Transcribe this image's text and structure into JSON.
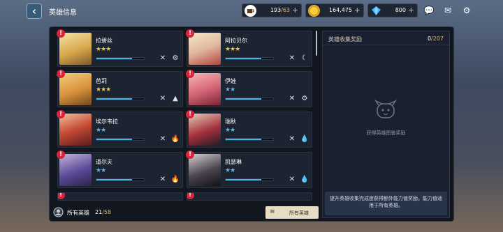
{
  "header": {
    "title": "英雄信息",
    "back_icon": "chevron-left-icon"
  },
  "resources": [
    {
      "icon": "coffee-cup-icon",
      "value": "193",
      "max": "/63",
      "color": "#e6b35a"
    },
    {
      "icon": "gold-coin-icon",
      "value": "164,475",
      "color": "#f2b21c"
    },
    {
      "icon": "diamond-gem-icon",
      "value": "800",
      "color": "#3fb6ff"
    }
  ],
  "toolbar": {
    "chat_icon": "chat-bubble-icon",
    "mail_icon": "mail-icon",
    "settings_icon": "gear-icon"
  },
  "heroes": [
    {
      "name": "拉碧丝",
      "stars": "★★★",
      "star_color": "#f3c739",
      "progress": 0.75,
      "skills": [
        "crossed-swords-icon",
        "gear-icon"
      ]
    },
    {
      "name": "阿拉贝尔",
      "stars": "★★★",
      "star_color": "#f3c739",
      "progress": 0.75,
      "skills": [
        "crossed-swords-icon",
        "crescent-icon"
      ]
    },
    {
      "name": "芭莉",
      "stars": "★★★",
      "star_color": "#f3c739",
      "progress": 0.75,
      "skills": [
        "crossed-swords-icon",
        "mountain-icon"
      ]
    },
    {
      "name": "伊娃",
      "stars": "★★",
      "star_color": "#55b9f0",
      "progress": 0.75,
      "skills": [
        "crossed-swords-icon",
        "gear-icon"
      ]
    },
    {
      "name": "埃尔韦拉",
      "stars": "★★",
      "star_color": "#55b9f0",
      "progress": 0.75,
      "skills": [
        "crossed-swords-icon",
        "flame-icon"
      ]
    },
    {
      "name": "瑞秋",
      "stars": "★★",
      "star_color": "#55b9f0",
      "progress": 0.75,
      "skills": [
        "crossed-swords-icon",
        "water-drop-icon"
      ]
    },
    {
      "name": "道尔夫",
      "stars": "★★",
      "star_color": "#55b9f0",
      "progress": 0.75,
      "skills": [
        "crossed-swords-icon",
        "flame-icon"
      ]
    },
    {
      "name": "凯瑟琳",
      "stars": "★★",
      "star_color": "#55b9f0",
      "progress": 0.75,
      "skills": [
        "crossed-swords-icon",
        "water-drop-icon"
      ]
    }
  ],
  "footer": {
    "label": "所有英雄",
    "count": "21",
    "total": "/58",
    "all_button": "所有英雄",
    "menu_icon": "list-icon"
  },
  "reward_panel": {
    "title": "英雄收集奖励",
    "count": "0",
    "total": "/207",
    "empty_text": "获得英雄图鉴奖励",
    "note": "提升英雄收集完成度获得额外能力值奖励。能力值适用于所有英雄。"
  },
  "colors": {
    "accent": "#d9b36a",
    "alert": "#d9253b",
    "bar": "#49b6e6"
  }
}
